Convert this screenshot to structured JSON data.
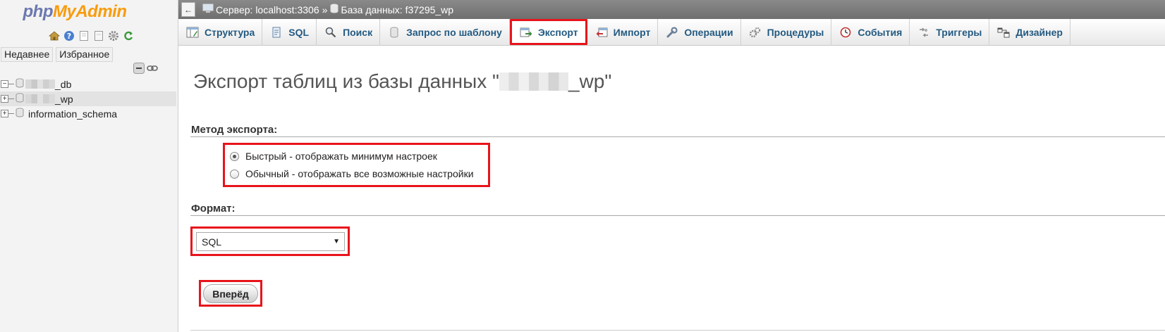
{
  "logo": {
    "part1": "php",
    "part2": "MyAdmin"
  },
  "nav": {
    "tabs": [
      "Недавнее",
      "Избранное"
    ],
    "tree": [
      {
        "suffix": "_db",
        "expander": "−"
      },
      {
        "suffix": "_wp",
        "expander": "+"
      },
      {
        "name": "information_schema",
        "expander": "+"
      }
    ]
  },
  "breadcrumb": {
    "collapse": "←",
    "server": "Сервер: localhost:3306",
    "separator": "»",
    "database": "База данных: f37295_wp"
  },
  "tabs": [
    {
      "label": "Структура",
      "icon": "structure-icon"
    },
    {
      "label": "SQL",
      "icon": "sql-icon"
    },
    {
      "label": "Поиск",
      "icon": "search-icon"
    },
    {
      "label": "Запрос по шаблону",
      "icon": "query-icon"
    },
    {
      "label": "Экспорт",
      "icon": "export-icon",
      "active": true
    },
    {
      "label": "Импорт",
      "icon": "import-icon"
    },
    {
      "label": "Операции",
      "icon": "wrench-icon"
    },
    {
      "label": "Процедуры",
      "icon": "routines-icon"
    },
    {
      "label": "События",
      "icon": "clock-icon"
    },
    {
      "label": "Триггеры",
      "icon": "trigger-icon"
    },
    {
      "label": "Дизайнер",
      "icon": "designer-icon"
    }
  ],
  "main": {
    "title_prefix": "Экспорт таблиц из базы данных \"",
    "title_suffix": "_wp\"",
    "method_label": "Метод экспорта:",
    "methods": [
      {
        "label": "Быстрый - отображать минимум настроек",
        "checked": true
      },
      {
        "label": "Обычный - отображать все возможные настройки",
        "checked": false
      }
    ],
    "format_label": "Формат:",
    "format_value": "SQL",
    "go_button": "Вперёд"
  },
  "colors": {
    "highlight": "#e8141b",
    "link": "#235a81",
    "logo_php": "#6c78af",
    "logo_myadmin": "#f89c0e"
  }
}
